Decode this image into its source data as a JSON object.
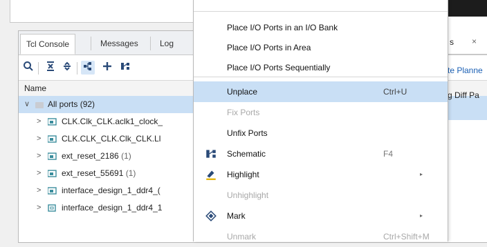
{
  "panel": {
    "tabs": [
      {
        "label": "Tcl Console"
      },
      {
        "label": "Messages"
      },
      {
        "label": "Log"
      }
    ],
    "right_tab_fragment": "s",
    "right_tab_close": "×",
    "link_fragment": "te Planne",
    "column_name": "Name",
    "column_right": "g Diff Pa",
    "tree": {
      "root_label": "All ports",
      "root_count": "(92)",
      "rows": [
        {
          "label": "CLK.Clk_CLK.aclk1_clock_",
          "count": ""
        },
        {
          "label": "CLK.CLK_CLK.Clk_CLK.Ll",
          "count": ""
        },
        {
          "label": "ext_reset_2186",
          "count": "(1)"
        },
        {
          "label": "ext_reset_55691",
          "count": "(1)"
        },
        {
          "label": "interface_design_1_ddr4_(",
          "count": ""
        },
        {
          "label": "interface_design_1_ddr4_1",
          "count": ""
        }
      ]
    }
  },
  "menu": {
    "items": [
      {
        "label": "Place I/O Ports in an I/O Bank",
        "shortcut": ""
      },
      {
        "label": "Place I/O Ports in Area",
        "shortcut": ""
      },
      {
        "label": "Place I/O Ports Sequentially",
        "shortcut": ""
      },
      {
        "label": "Unplace",
        "shortcut": "Ctrl+U"
      },
      {
        "label": "Fix Ports",
        "shortcut": ""
      },
      {
        "label": "Unfix Ports",
        "shortcut": ""
      },
      {
        "label": "Schematic",
        "shortcut": "F4"
      },
      {
        "label": "Highlight",
        "shortcut": ""
      },
      {
        "label": "Unhighlight",
        "shortcut": ""
      },
      {
        "label": "Mark",
        "shortcut": ""
      },
      {
        "label": "Unmark",
        "shortcut": "Ctrl+Shift+M"
      }
    ],
    "submenu_arrow": "▸"
  },
  "icons": {
    "search": "search-icon",
    "collapse_all": "collapse-all-icon",
    "expand_all": "expand-all-icon",
    "group": "group-icon",
    "add": "plus-icon",
    "schematic": "schematic-icon"
  },
  "colors": {
    "selection": "#c9dff5",
    "link": "#1a5fb4",
    "disabled_text": "#a8a8a8"
  }
}
